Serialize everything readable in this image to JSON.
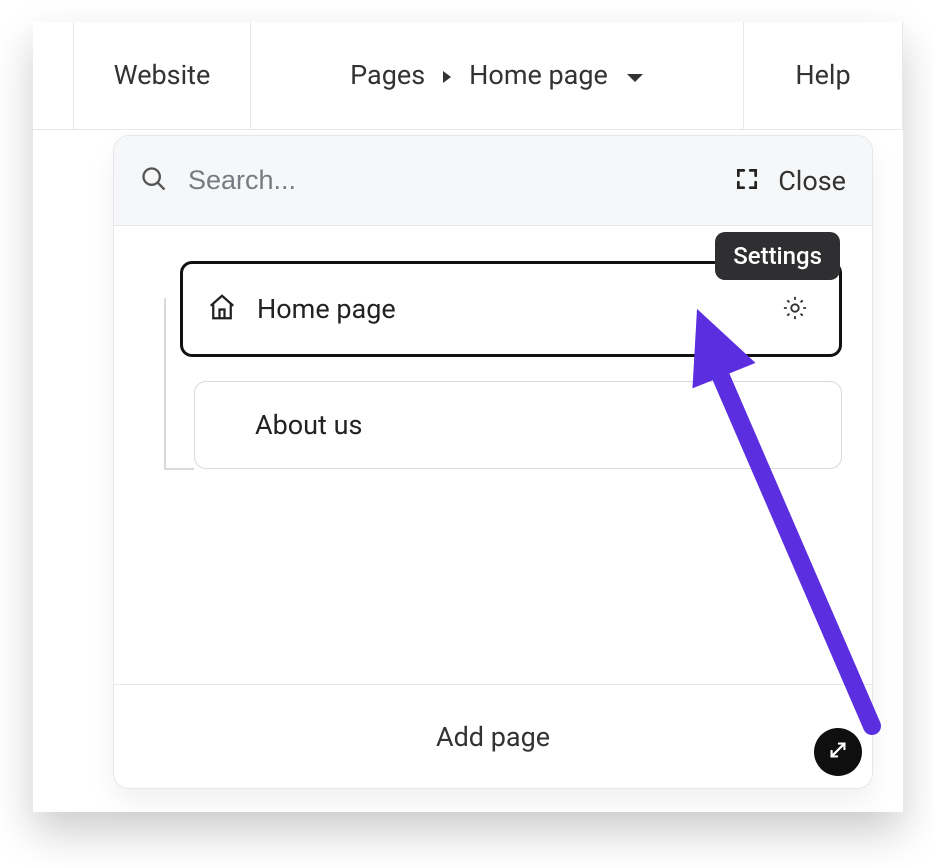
{
  "topbar": {
    "website_label": "Website",
    "pages_label": "Pages",
    "current_page": "Home page",
    "help_label": "Help"
  },
  "panel": {
    "search_placeholder": "Search...",
    "close_label": "Close",
    "settings_tooltip": "Settings",
    "add_page_label": "Add page",
    "pages": [
      {
        "label": "Home page",
        "is_home": true,
        "selected": true
      },
      {
        "label": "About us",
        "is_home": false,
        "selected": false
      }
    ]
  },
  "colors": {
    "annotation": "#5b2ee0",
    "border": "#d8dadd"
  }
}
